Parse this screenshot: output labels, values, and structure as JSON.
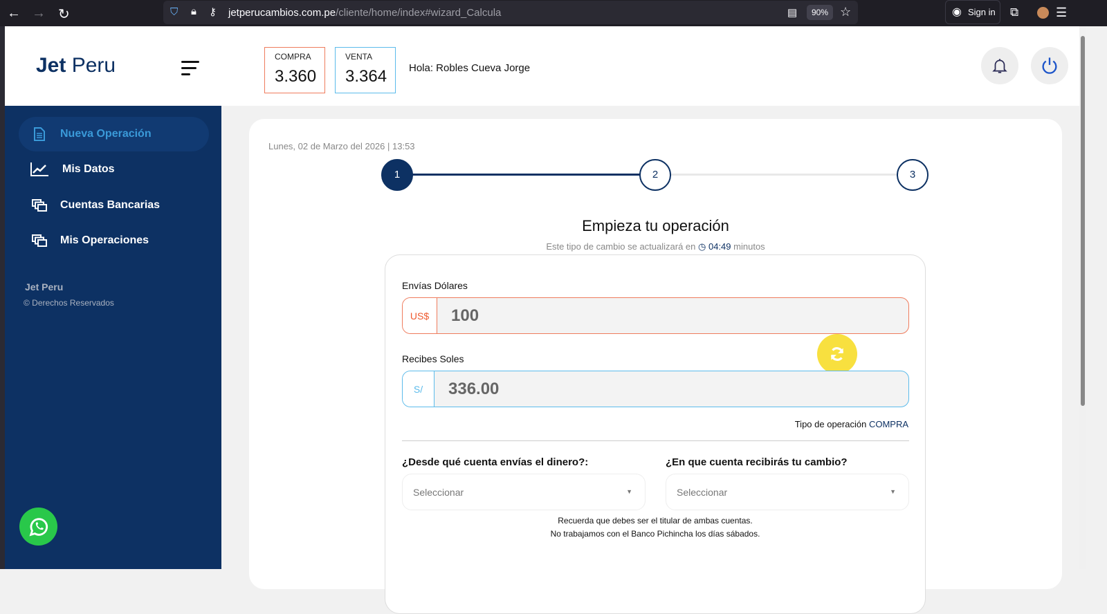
{
  "browser": {
    "url_host": "jetperucambios.com.pe",
    "url_path": "/cliente/home/index#wizard_Calcula",
    "zoom": "90%",
    "sign_in": "Sign in"
  },
  "header": {
    "logo_bold": "Jet",
    "logo_rest": " Peru",
    "compra_label": "COMPRA",
    "compra_value": "3.360",
    "venta_label": "VENTA",
    "venta_value": "3.364",
    "greeting": "Hola: Robles Cueva Jorge"
  },
  "sidebar": {
    "items": [
      {
        "label": "Nueva Operación"
      },
      {
        "label": "Mis Datos"
      },
      {
        "label": "Cuentas Bancarias"
      },
      {
        "label": "Mis Operaciones"
      }
    ],
    "footer_title": "Jet Peru",
    "footer_copy": "© Derechos Reservados"
  },
  "main": {
    "date": "Lunes, 02 de Marzo del 2026 | 13:53",
    "steps": [
      "1",
      "2",
      "3"
    ],
    "current_step": 1,
    "title": "Empieza tu operación",
    "timer_prefix": "Este tipo de cambio se actualizará en",
    "timer": "04:49",
    "timer_suffix": "minutos",
    "send_label": "Envías Dólares",
    "send_currency": "US$",
    "send_value": "100",
    "receive_label": "Recibes Soles",
    "receive_currency": "S/",
    "receive_value": "336.00",
    "op_type_label": "Tipo de operación",
    "op_type": "COMPRA",
    "from_label": "¿Desde qué cuenta envías el dinero?:",
    "to_label": "¿En que cuenta recibirás tu cambio?",
    "select_placeholder": "Seleccionar",
    "note1": "Recuerda que debes ser el titular de ambas cuentas.",
    "note2": "No trabajamos con el Banco Pichincha los días sábados."
  },
  "colors": {
    "navy": "#0d3163",
    "orange": "#ef7b5c",
    "blue": "#5bbbeb",
    "yellow": "#f8e03f"
  }
}
